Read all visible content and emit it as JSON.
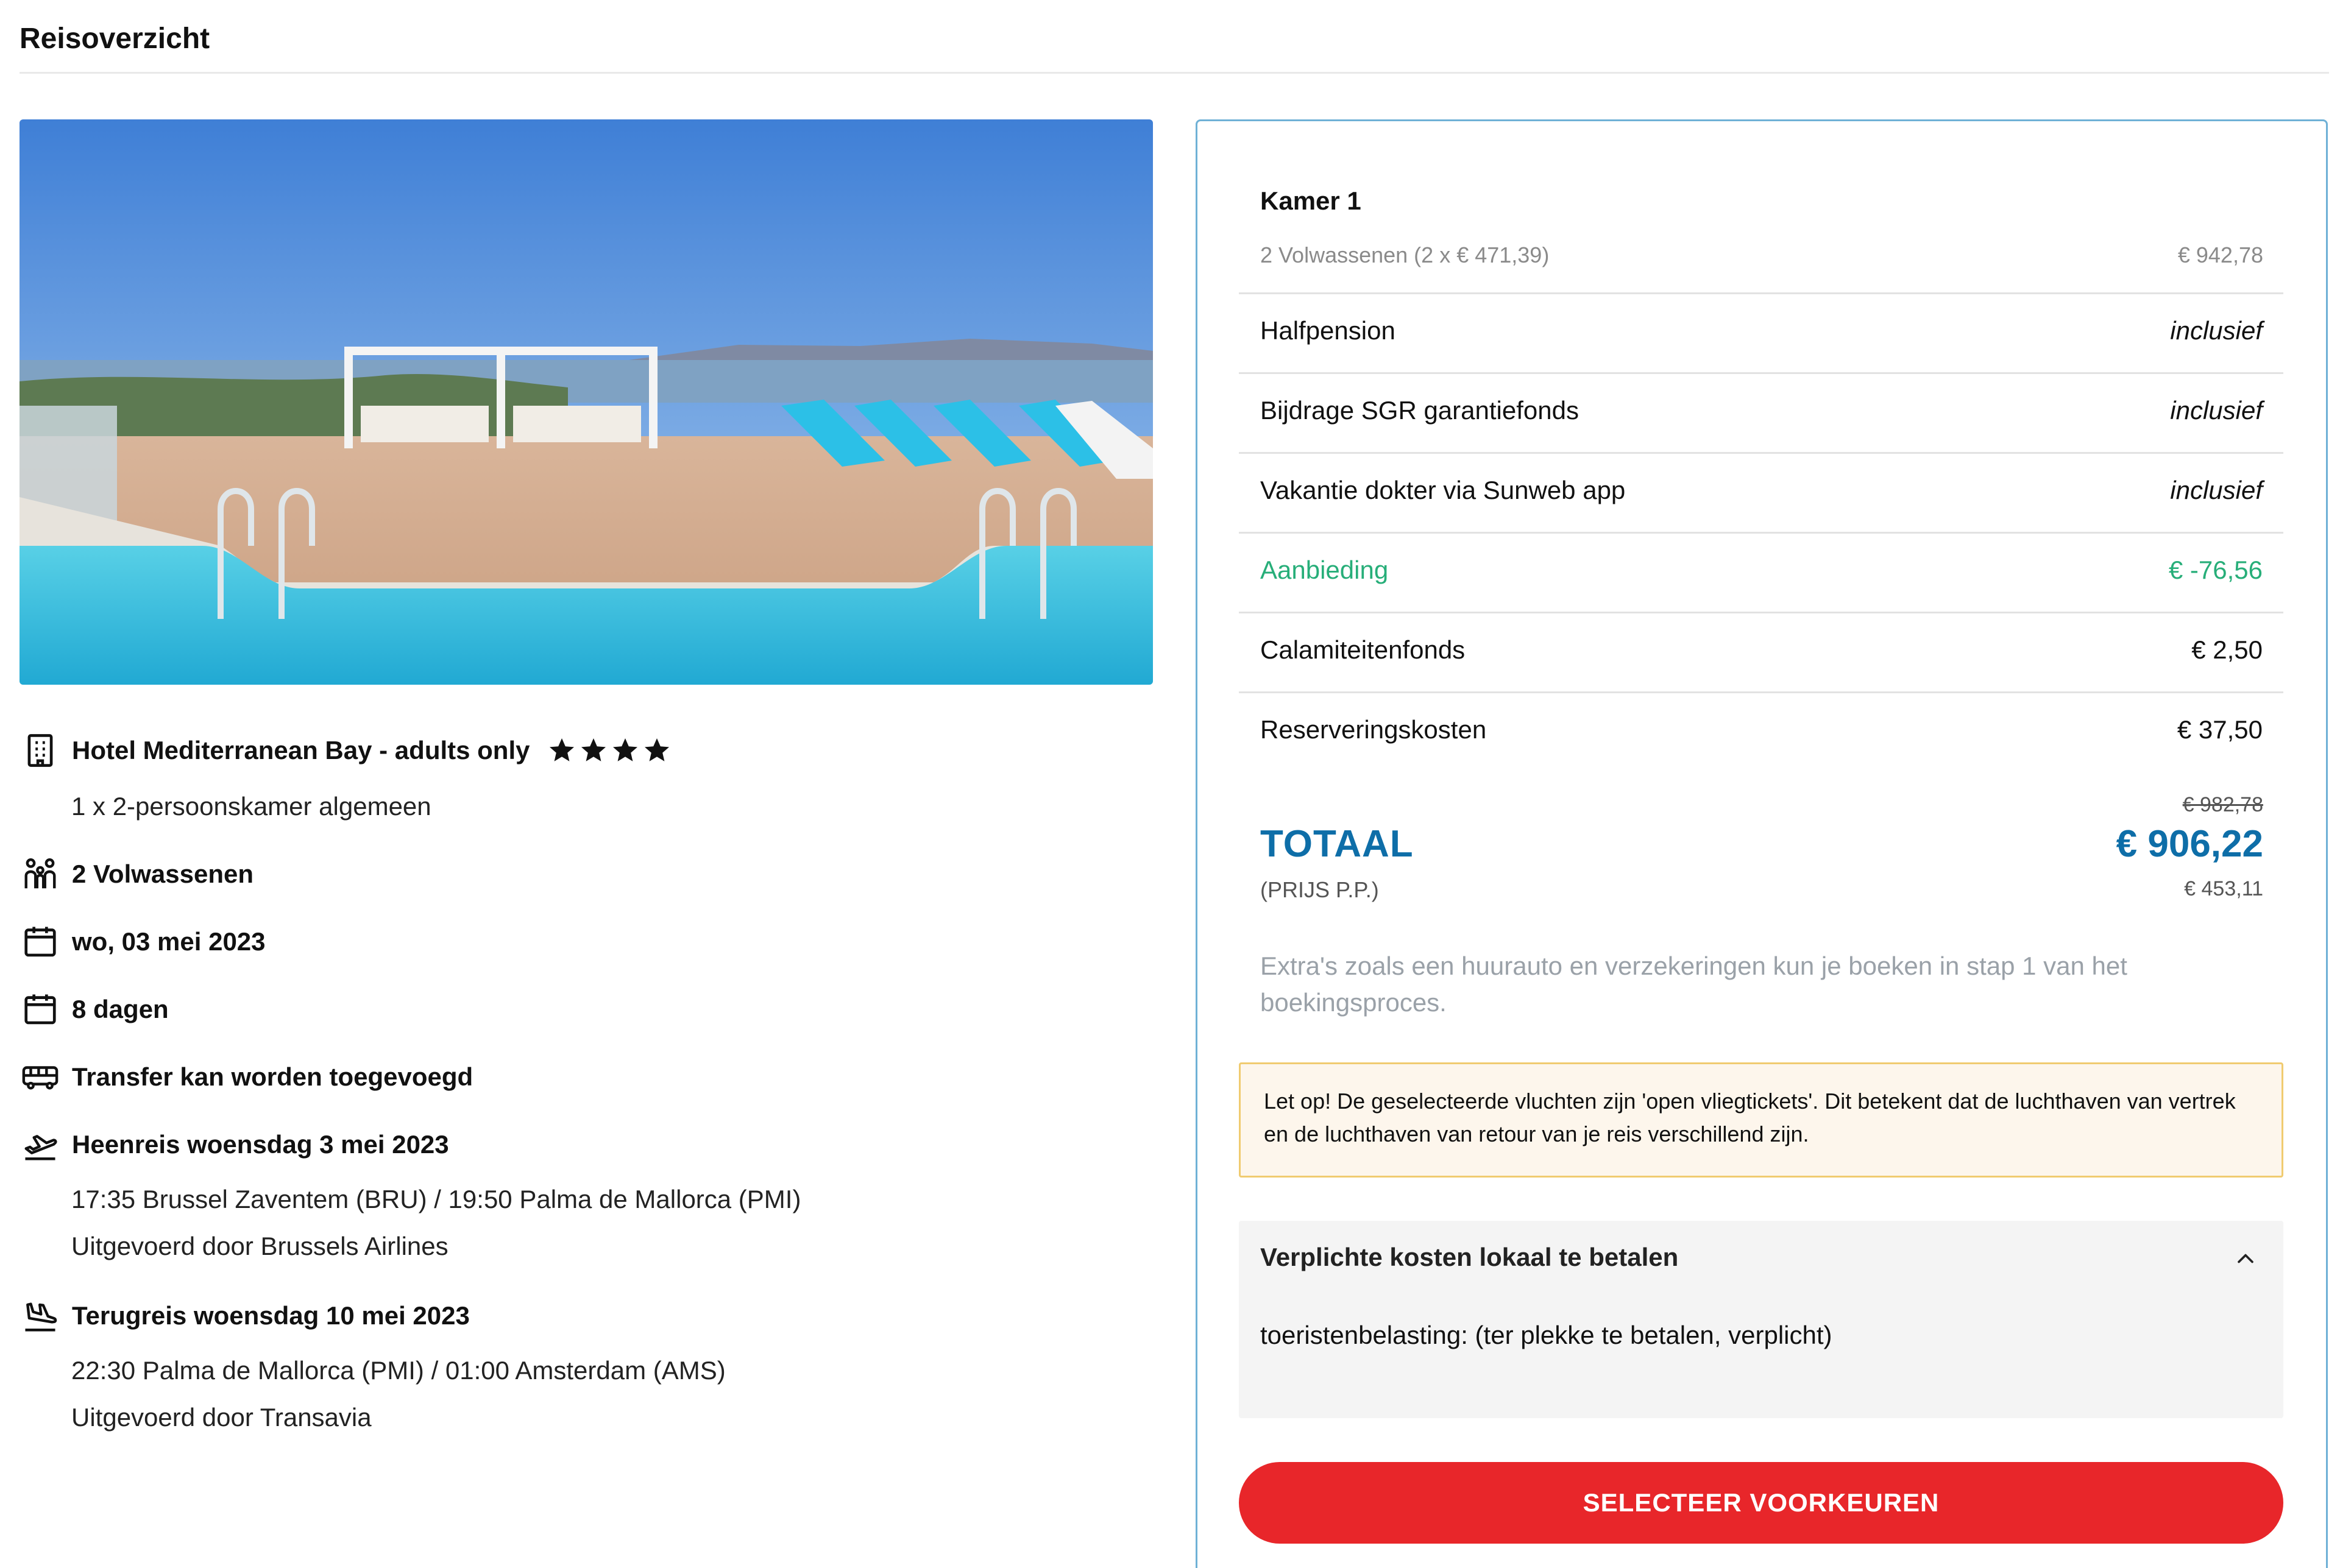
{
  "page": {
    "title": "Reisoverzicht"
  },
  "hotel": {
    "name": "Hotel Mediterranean Bay - adults only",
    "stars": 4,
    "room": "1 x 2-persoonskamer algemeen",
    "image_icon": "rooftop-pool-photo"
  },
  "details": {
    "travellers": "2 Volwassenen",
    "date": "wo, 03 mei 2023",
    "duration": "8 dagen",
    "transfer": "Transfer kan worden toegevoegd",
    "outbound": {
      "title": "Heenreis woensdag 3 mei 2023",
      "route": "17:35 Brussel Zaventem (BRU) / 19:50 Palma de Mallorca (PMI)",
      "carrier": "Uitgevoerd door Brussels Airlines"
    },
    "return": {
      "title": "Terugreis woensdag 10 mei 2023",
      "route": "22:30 Palma de Mallorca (PMI) / 01:00 Amsterdam (AMS)",
      "carrier": "Uitgevoerd door Transavia"
    }
  },
  "price": {
    "room_title": "Kamer 1",
    "room_sub": "2 Volwassenen (2 x € 471,39)",
    "room_price": "€ 942,78",
    "lines": [
      {
        "label": "Halfpension",
        "value": "inclusief"
      },
      {
        "label": "Bijdrage SGR garantiefonds",
        "value": "inclusief"
      },
      {
        "label": "Vakantie dokter via Sunweb app",
        "value": "inclusief"
      },
      {
        "label": "Aanbieding",
        "value": "€ -76,56"
      },
      {
        "label": "Calamiteitenfonds",
        "value": "€ 2,50"
      },
      {
        "label": "Reserveringskosten",
        "value": "€ 37,50"
      }
    ],
    "old_total": "€ 982,78",
    "total_label": "TOTAAL",
    "total": "€ 906,22",
    "per_person_label": "(PRIJS P.P.)",
    "per_person": "€ 453,11",
    "extras_note": "Extra's zoals een huurauto en verzekeringen kun je boeken in stap 1 van het boekingsproces.",
    "warning": "Let op! De geselecteerde vluchten zijn 'open vliegtickets'. Dit betekent dat de luchthaven van vertrek en de luchthaven van retour van je reis verschillend zijn.",
    "local_costs": {
      "title": "Verplichte kosten lokaal te betalen",
      "body": "toeristenbelasting: (ter plekke te betalen, verplicht)"
    },
    "cta": "SELECTEER VOORKEUREN"
  },
  "colors": {
    "accent_blue": "#0e6ea8",
    "offer_green": "#27ae79",
    "cta_red": "#e8262a",
    "card_border": "#6fb1d6",
    "warning_bg": "#fdf6ec",
    "warning_border": "#f0cb70"
  },
  "icons": {
    "hotel": "building-icon",
    "travellers": "people-icon",
    "date": "calendar-icon",
    "duration": "calendar-icon",
    "transfer": "bus-icon",
    "outbound": "plane-departure-icon",
    "return": "plane-arrival-icon",
    "collapse": "chevron-up-icon"
  }
}
